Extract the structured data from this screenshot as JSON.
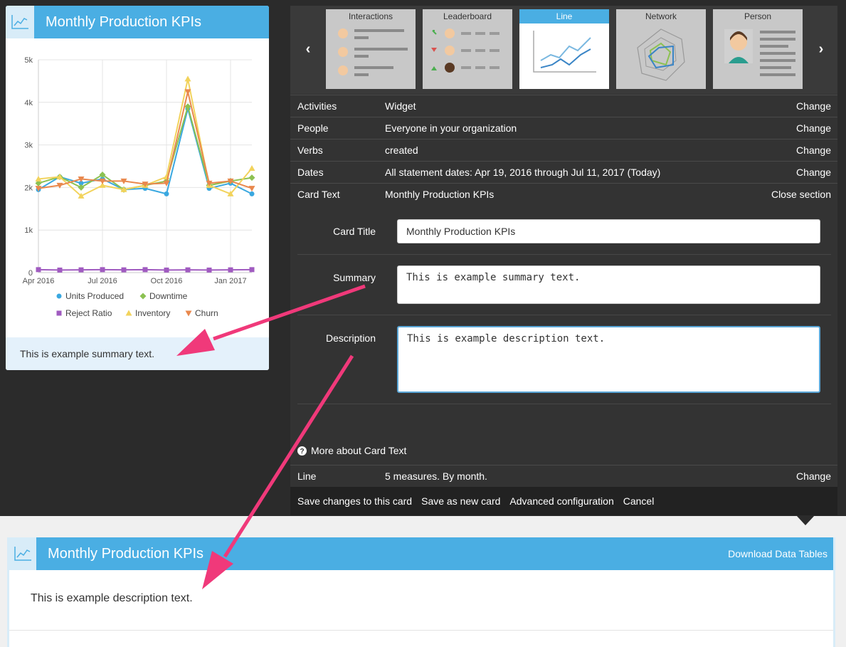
{
  "left_card": {
    "title": "Monthly Production KPIs",
    "summary": "This is example summary text."
  },
  "chart_data": {
    "type": "line",
    "x": [
      "Apr 2016",
      "May 2016",
      "Jun 2016",
      "Jul 2016",
      "Aug 2016",
      "Sep 2016",
      "Oct 2016",
      "Nov 2016",
      "Dec 2016",
      "Jan 2017",
      "Feb 2017"
    ],
    "x_tick_labels": [
      "Apr 2016",
      "Jul 2016",
      "Oct 2016",
      "Jan 2017"
    ],
    "y_tick_labels": [
      "0",
      "1k",
      "2k",
      "3k",
      "4k",
      "5k"
    ],
    "ylim": [
      0,
      5000
    ],
    "grid": true,
    "legend_position": "bottom",
    "series": [
      {
        "name": "Units Produced",
        "color": "#3aa8e0",
        "marker": "circle",
        "values": [
          1950,
          2250,
          2100,
          2200,
          1950,
          1980,
          1850,
          3850,
          1980,
          2100,
          1850
        ]
      },
      {
        "name": "Downtime",
        "color": "#8cc152",
        "marker": "diamond",
        "values": [
          2100,
          2250,
          2000,
          2300,
          1950,
          2050,
          2150,
          3900,
          2050,
          2150,
          2230
        ]
      },
      {
        "name": "Reject Ratio",
        "color": "#a05bc0",
        "marker": "square",
        "values": [
          70,
          60,
          65,
          70,
          65,
          70,
          60,
          65,
          60,
          65,
          70
        ]
      },
      {
        "name": "Inventory",
        "color": "#f2d35c",
        "marker": "triangle",
        "values": [
          2200,
          2250,
          1800,
          2050,
          1950,
          2050,
          2250,
          4550,
          2050,
          1850,
          2450
        ]
      },
      {
        "name": "Churn",
        "color": "#e9884d",
        "marker": "tri-down",
        "values": [
          1980,
          2050,
          2200,
          2150,
          2150,
          2080,
          2100,
          4250,
          2100,
          2150,
          1980
        ]
      }
    ]
  },
  "carousel": {
    "prev_icon": "chevron-left-icon",
    "next_icon": "chevron-right-icon",
    "tiles": [
      {
        "label": "Interactions",
        "active": false
      },
      {
        "label": "Leaderboard",
        "active": false
      },
      {
        "label": "Line",
        "active": true
      },
      {
        "label": "Network",
        "active": false
      },
      {
        "label": "Person",
        "active": false
      }
    ]
  },
  "settings": [
    {
      "label": "Activities",
      "value": "Widget",
      "action": "Change"
    },
    {
      "label": "People",
      "value": "Everyone in your organization",
      "action": "Change"
    },
    {
      "label": "Verbs",
      "value": "created",
      "action": "Change"
    },
    {
      "label": "Dates",
      "value": "All statement dates: Apr 19, 2016 through Jul 11, 2017 (Today)",
      "action": "Change"
    },
    {
      "label": "Card Text",
      "value": "Monthly Production KPIs",
      "action": "Close section"
    }
  ],
  "form": {
    "card_title_label": "Card Title",
    "card_title_value": "Monthly Production KPIs",
    "summary_label": "Summary",
    "summary_value": "This is example summary text.",
    "description_label": "Description",
    "description_value": "This is example description text."
  },
  "more_about": "More about Card Text",
  "line_row": {
    "label": "Line",
    "value": "5 measures. By month.",
    "action": "Change"
  },
  "actions": {
    "save": "Save changes to this card",
    "save_new": "Save as new card",
    "advanced": "Advanced configuration",
    "cancel": "Cancel"
  },
  "bottom_card": {
    "title": "Monthly Production KPIs",
    "download": "Download Data Tables",
    "description": "This is example description text."
  },
  "colors": {
    "accent": "#4aaee3",
    "annotation_arrow": "#f0397a"
  }
}
